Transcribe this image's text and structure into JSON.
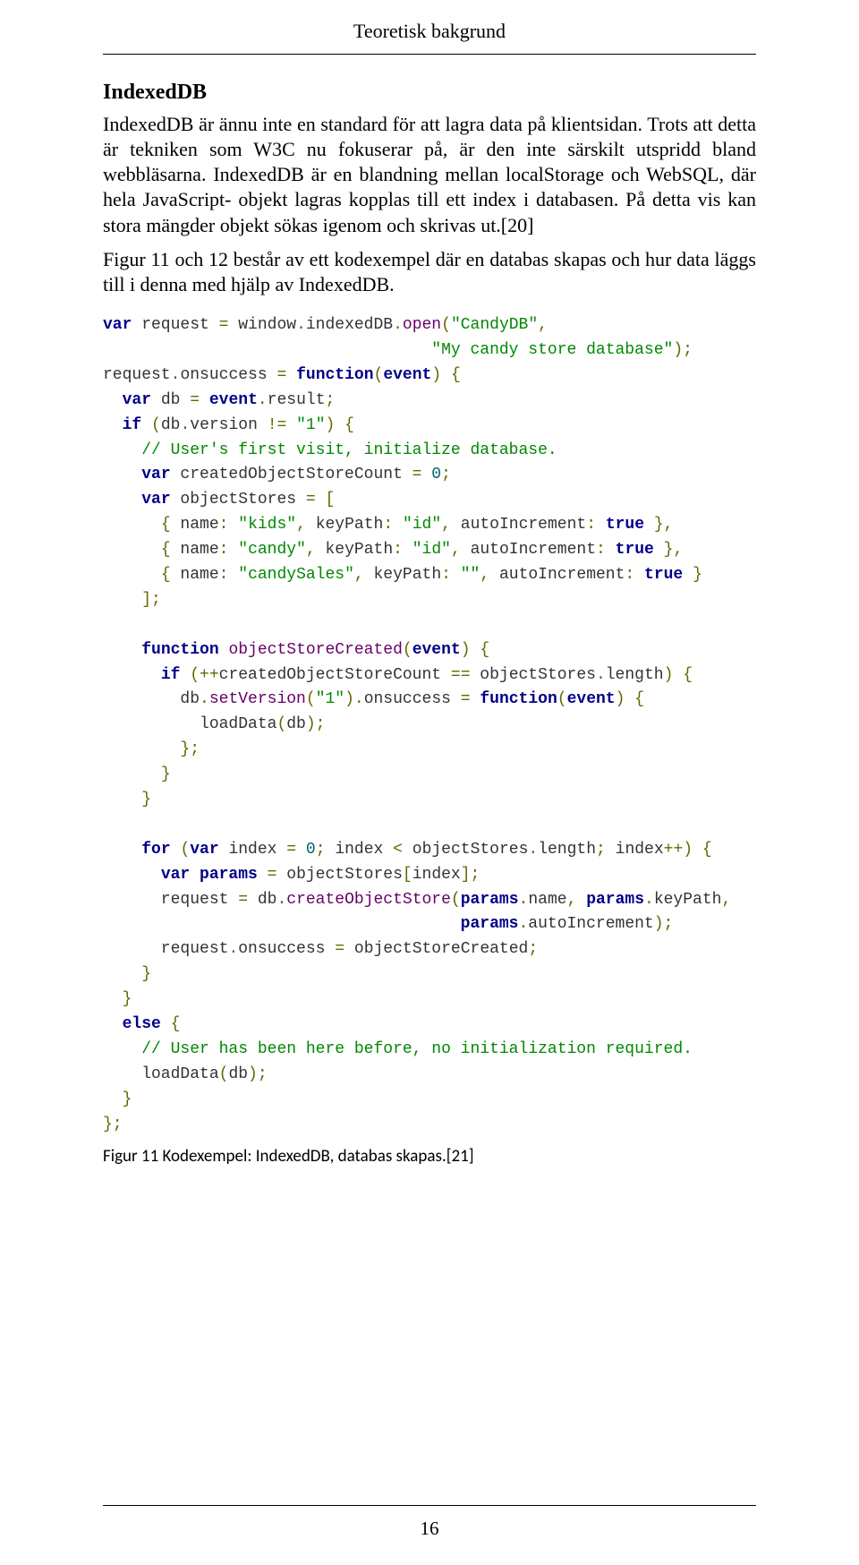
{
  "running_header": "Teoretisk bakgrund",
  "section_title": "IndexedDB",
  "paragraph1": "IndexedDB är ännu inte en standard för att lagra data på klientsidan. Trots att detta är tekniken som W3C nu fokuserar på, är den inte särskilt utspridd bland webbläsarna. IndexedDB är en blandning mellan localStorage och WebSQL, där hela JavaScript- objekt lagras kopplas till ett index i databasen. På detta vis kan stora mängder objekt sökas igenom och skrivas ut.[20]",
  "paragraph2": "Figur 11 och 12 består av ett kodexempel där en databas skapas och hur data läggs till i denna med hjälp av IndexedDB.",
  "code_lines": [
    [
      [
        "kw",
        "var"
      ],
      [
        "pl",
        " request "
      ],
      [
        "op",
        "="
      ],
      [
        "pl",
        " window"
      ],
      [
        "op",
        "."
      ],
      [
        "pl",
        "indexedDB"
      ],
      [
        "op",
        "."
      ],
      [
        "nm",
        "open"
      ],
      [
        "op",
        "("
      ],
      [
        "str",
        "\"CandyDB\""
      ],
      [
        "op",
        ","
      ]
    ],
    [
      [
        "pl",
        "                                  "
      ],
      [
        "str",
        "\"My candy store database\""
      ],
      [
        "op",
        ");"
      ]
    ],
    [
      [
        "pl",
        "request"
      ],
      [
        "op",
        "."
      ],
      [
        "pl",
        "onsuccess "
      ],
      [
        "op",
        "="
      ],
      [
        "pl",
        " "
      ],
      [
        "kw",
        "function"
      ],
      [
        "op",
        "("
      ],
      [
        "kw",
        "event"
      ],
      [
        "op",
        ")"
      ],
      [
        "pl",
        " "
      ],
      [
        "op",
        "{"
      ]
    ],
    [
      [
        "pl",
        "  "
      ],
      [
        "kw",
        "var"
      ],
      [
        "pl",
        " db "
      ],
      [
        "op",
        "="
      ],
      [
        "pl",
        " "
      ],
      [
        "kw",
        "event"
      ],
      [
        "op",
        "."
      ],
      [
        "pl",
        "result"
      ],
      [
        "op",
        ";"
      ]
    ],
    [
      [
        "pl",
        "  "
      ],
      [
        "kw",
        "if"
      ],
      [
        "pl",
        " "
      ],
      [
        "op",
        "("
      ],
      [
        "pl",
        "db"
      ],
      [
        "op",
        "."
      ],
      [
        "pl",
        "version "
      ],
      [
        "op",
        "!="
      ],
      [
        "pl",
        " "
      ],
      [
        "str",
        "\"1\""
      ],
      [
        "op",
        ")"
      ],
      [
        "pl",
        " "
      ],
      [
        "op",
        "{"
      ]
    ],
    [
      [
        "pl",
        "    "
      ],
      [
        "cm",
        "// User's first visit, initialize database."
      ]
    ],
    [
      [
        "pl",
        "    "
      ],
      [
        "kw",
        "var"
      ],
      [
        "pl",
        " createdObjectStoreCount "
      ],
      [
        "op",
        "="
      ],
      [
        "pl",
        " "
      ],
      [
        "num",
        "0"
      ],
      [
        "op",
        ";"
      ]
    ],
    [
      [
        "pl",
        "    "
      ],
      [
        "kw",
        "var"
      ],
      [
        "pl",
        " objectStores "
      ],
      [
        "op",
        "="
      ],
      [
        "pl",
        " "
      ],
      [
        "op",
        "["
      ]
    ],
    [
      [
        "pl",
        "      "
      ],
      [
        "op",
        "{"
      ],
      [
        "pl",
        " name"
      ],
      [
        "op",
        ":"
      ],
      [
        "pl",
        " "
      ],
      [
        "str",
        "\"kids\""
      ],
      [
        "op",
        ","
      ],
      [
        "pl",
        " keyPath"
      ],
      [
        "op",
        ":"
      ],
      [
        "pl",
        " "
      ],
      [
        "str",
        "\"id\""
      ],
      [
        "op",
        ","
      ],
      [
        "pl",
        " autoIncrement"
      ],
      [
        "op",
        ":"
      ],
      [
        "pl",
        " "
      ],
      [
        "kw",
        "true"
      ],
      [
        "pl",
        " "
      ],
      [
        "op",
        "},"
      ]
    ],
    [
      [
        "pl",
        "      "
      ],
      [
        "op",
        "{"
      ],
      [
        "pl",
        " name"
      ],
      [
        "op",
        ":"
      ],
      [
        "pl",
        " "
      ],
      [
        "str",
        "\"candy\""
      ],
      [
        "op",
        ","
      ],
      [
        "pl",
        " keyPath"
      ],
      [
        "op",
        ":"
      ],
      [
        "pl",
        " "
      ],
      [
        "str",
        "\"id\""
      ],
      [
        "op",
        ","
      ],
      [
        "pl",
        " autoIncrement"
      ],
      [
        "op",
        ":"
      ],
      [
        "pl",
        " "
      ],
      [
        "kw",
        "true"
      ],
      [
        "pl",
        " "
      ],
      [
        "op",
        "},"
      ]
    ],
    [
      [
        "pl",
        "      "
      ],
      [
        "op",
        "{"
      ],
      [
        "pl",
        " name"
      ],
      [
        "op",
        ":"
      ],
      [
        "pl",
        " "
      ],
      [
        "str",
        "\"candySales\""
      ],
      [
        "op",
        ","
      ],
      [
        "pl",
        " keyPath"
      ],
      [
        "op",
        ":"
      ],
      [
        "pl",
        " "
      ],
      [
        "str",
        "\"\""
      ],
      [
        "op",
        ","
      ],
      [
        "pl",
        " autoIncrement"
      ],
      [
        "op",
        ":"
      ],
      [
        "pl",
        " "
      ],
      [
        "kw",
        "true"
      ],
      [
        "pl",
        " "
      ],
      [
        "op",
        "}"
      ]
    ],
    [
      [
        "pl",
        "    "
      ],
      [
        "op",
        "];"
      ]
    ],
    [
      [
        "pl",
        " "
      ]
    ],
    [
      [
        "pl",
        "    "
      ],
      [
        "kw",
        "function"
      ],
      [
        "pl",
        " "
      ],
      [
        "nm",
        "objectStoreCreated"
      ],
      [
        "op",
        "("
      ],
      [
        "kw",
        "event"
      ],
      [
        "op",
        ")"
      ],
      [
        "pl",
        " "
      ],
      [
        "op",
        "{"
      ]
    ],
    [
      [
        "pl",
        "      "
      ],
      [
        "kw",
        "if"
      ],
      [
        "pl",
        " "
      ],
      [
        "op",
        "(++"
      ],
      [
        "pl",
        "createdObjectStoreCount "
      ],
      [
        "op",
        "=="
      ],
      [
        "pl",
        " objectStores"
      ],
      [
        "op",
        "."
      ],
      [
        "pl",
        "length"
      ],
      [
        "op",
        ")"
      ],
      [
        "pl",
        " "
      ],
      [
        "op",
        "{"
      ]
    ],
    [
      [
        "pl",
        "        db"
      ],
      [
        "op",
        "."
      ],
      [
        "nm",
        "setVersion"
      ],
      [
        "op",
        "("
      ],
      [
        "str",
        "\"1\""
      ],
      [
        "op",
        ")."
      ],
      [
        "pl",
        "onsuccess "
      ],
      [
        "op",
        "="
      ],
      [
        "pl",
        " "
      ],
      [
        "kw",
        "function"
      ],
      [
        "op",
        "("
      ],
      [
        "kw",
        "event"
      ],
      [
        "op",
        ")"
      ],
      [
        "pl",
        " "
      ],
      [
        "op",
        "{"
      ]
    ],
    [
      [
        "pl",
        "          loadData"
      ],
      [
        "op",
        "("
      ],
      [
        "pl",
        "db"
      ],
      [
        "op",
        ");"
      ]
    ],
    [
      [
        "pl",
        "        "
      ],
      [
        "op",
        "};"
      ]
    ],
    [
      [
        "pl",
        "      "
      ],
      [
        "op",
        "}"
      ]
    ],
    [
      [
        "pl",
        "    "
      ],
      [
        "op",
        "}"
      ]
    ],
    [
      [
        "pl",
        " "
      ]
    ],
    [
      [
        "pl",
        "    "
      ],
      [
        "kw",
        "for"
      ],
      [
        "pl",
        " "
      ],
      [
        "op",
        "("
      ],
      [
        "kw",
        "var"
      ],
      [
        "pl",
        " index "
      ],
      [
        "op",
        "="
      ],
      [
        "pl",
        " "
      ],
      [
        "num",
        "0"
      ],
      [
        "op",
        ";"
      ],
      [
        "pl",
        " index "
      ],
      [
        "op",
        "<"
      ],
      [
        "pl",
        " objectStores"
      ],
      [
        "op",
        "."
      ],
      [
        "pl",
        "length"
      ],
      [
        "op",
        ";"
      ],
      [
        "pl",
        " index"
      ],
      [
        "op",
        "++)"
      ],
      [
        "pl",
        " "
      ],
      [
        "op",
        "{"
      ]
    ],
    [
      [
        "pl",
        "      "
      ],
      [
        "kw",
        "var"
      ],
      [
        "pl",
        " "
      ],
      [
        "kw",
        "params"
      ],
      [
        "pl",
        " "
      ],
      [
        "op",
        "="
      ],
      [
        "pl",
        " objectStores"
      ],
      [
        "op",
        "["
      ],
      [
        "pl",
        "index"
      ],
      [
        "op",
        "];"
      ]
    ],
    [
      [
        "pl",
        "      request "
      ],
      [
        "op",
        "="
      ],
      [
        "pl",
        " db"
      ],
      [
        "op",
        "."
      ],
      [
        "nm",
        "createObjectStore"
      ],
      [
        "op",
        "("
      ],
      [
        "kw",
        "params"
      ],
      [
        "op",
        "."
      ],
      [
        "pl",
        "name"
      ],
      [
        "op",
        ","
      ],
      [
        "pl",
        " "
      ],
      [
        "kw",
        "params"
      ],
      [
        "op",
        "."
      ],
      [
        "pl",
        "keyPath"
      ],
      [
        "op",
        ","
      ]
    ],
    [
      [
        "pl",
        "                                     "
      ],
      [
        "kw",
        "params"
      ],
      [
        "op",
        "."
      ],
      [
        "pl",
        "autoIncrement"
      ],
      [
        "op",
        ");"
      ]
    ],
    [
      [
        "pl",
        "      request"
      ],
      [
        "op",
        "."
      ],
      [
        "pl",
        "onsuccess "
      ],
      [
        "op",
        "="
      ],
      [
        "pl",
        " objectStoreCreated"
      ],
      [
        "op",
        ";"
      ]
    ],
    [
      [
        "pl",
        "    "
      ],
      [
        "op",
        "}"
      ]
    ],
    [
      [
        "pl",
        "  "
      ],
      [
        "op",
        "}"
      ]
    ],
    [
      [
        "pl",
        "  "
      ],
      [
        "kw",
        "else"
      ],
      [
        "pl",
        " "
      ],
      [
        "op",
        "{"
      ]
    ],
    [
      [
        "pl",
        "    "
      ],
      [
        "cm",
        "// User has been here before, no initialization required."
      ]
    ],
    [
      [
        "pl",
        "    loadData"
      ],
      [
        "op",
        "("
      ],
      [
        "pl",
        "db"
      ],
      [
        "op",
        ");"
      ]
    ],
    [
      [
        "pl",
        "  "
      ],
      [
        "op",
        "}"
      ]
    ],
    [
      [
        "op",
        "};"
      ]
    ]
  ],
  "figure_caption": "Figur 11 Kodexempel: IndexedDB, databas skapas.[21]",
  "page_number": "16"
}
